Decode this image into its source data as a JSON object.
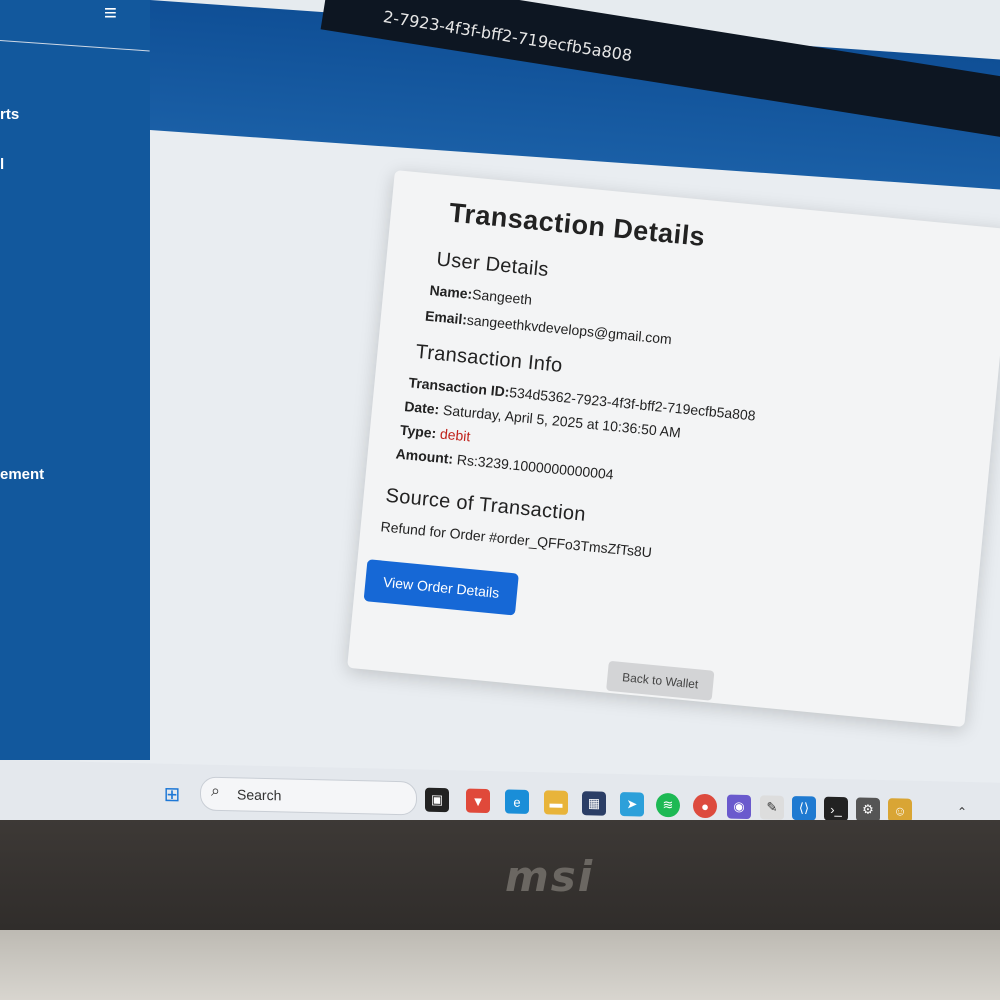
{
  "sidebar": {
    "items": [
      {
        "label": "rts"
      },
      {
        "label": "l"
      },
      {
        "label": "ement"
      }
    ]
  },
  "address_bar": {
    "text": "2-7923-4f3f-bff2-719ecfb5a808"
  },
  "card": {
    "title": "Transaction Details",
    "user_section": {
      "heading": "User Details",
      "name_label": "Name:",
      "name_value": "Sangeeth",
      "email_label": "Email:",
      "email_value": "sangeethkvdevelops@gmail.com"
    },
    "info_section": {
      "heading": "Transaction Info",
      "id_label": "Transaction ID:",
      "id_value": "534d5362-7923-4f3f-bff2-719ecfb5a808",
      "date_label": "Date:",
      "date_value": "Saturday, April 5, 2025 at 10:36:50 AM",
      "type_label": "Type:",
      "type_value": "debit",
      "amount_label": "Amount:",
      "amount_value": "Rs:3239.1000000000004"
    },
    "source_section": {
      "heading": "Source of Transaction",
      "text": "Refund for Order #order_QFFo3TmsZfTs8U"
    },
    "view_order_button": "View Order Details",
    "back_button": "Back to Wallet",
    "debit_color": "#c0221b",
    "primary_color": "#1668d6"
  },
  "taskbar": {
    "search_placeholder": "Search",
    "icons": [
      "windows-start-icon",
      "search-icon",
      "widgets-icon",
      "task-view-icon",
      "brave-icon",
      "edge-icon",
      "file-explorer-icon",
      "store-icon",
      "telegram-icon",
      "spotify-icon",
      "chrome-icon",
      "photo-app-icon",
      "pen-icon",
      "vscode-icon",
      "terminal-icon",
      "settings-icon",
      "notes-app-icon"
    ]
  },
  "laptop": {
    "brand": "msi"
  }
}
